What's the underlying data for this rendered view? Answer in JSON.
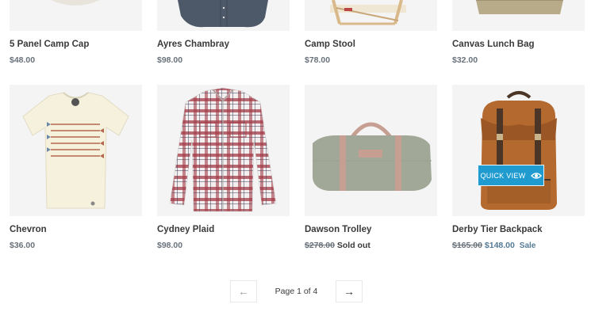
{
  "products": [
    {
      "title": "5 Panel Camp Cap",
      "price": "$48.00"
    },
    {
      "title": "Ayres Chambray",
      "price": "$98.00"
    },
    {
      "title": "Camp Stool",
      "price": "$78.00"
    },
    {
      "title": "Canvas Lunch Bag",
      "price": "$32.00"
    },
    {
      "title": "Chevron",
      "price": "$36.00"
    },
    {
      "title": "Cydney Plaid",
      "price": "$98.00"
    },
    {
      "title": "Dawson Trolley",
      "compare_price": "$278.00",
      "status": "Sold out"
    },
    {
      "title": "Derby Tier Backpack",
      "compare_price": "$165.00",
      "sale_price": "$148.00",
      "badge": "Sale",
      "quick_view": "QUICK VIEW"
    }
  ],
  "pagination": {
    "prev": "←",
    "label": "Page 1 of 4",
    "next": "→"
  },
  "colors": {
    "accent": "#1f9bd0",
    "sale": "#557b97",
    "price": "#69727b"
  }
}
